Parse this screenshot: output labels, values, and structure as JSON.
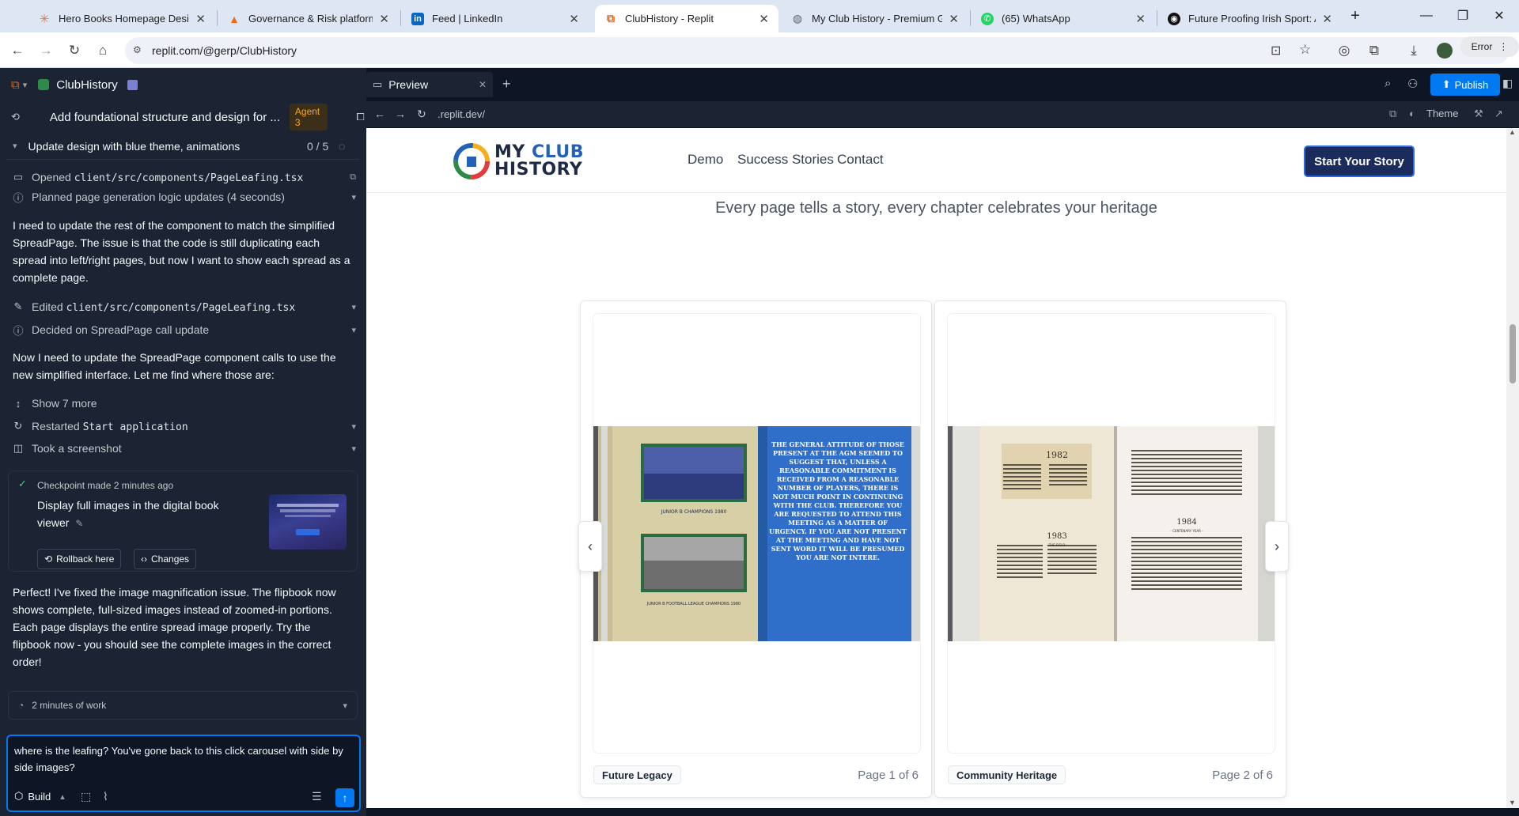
{
  "browser": {
    "tabs": [
      {
        "title": "Hero Books Homepage Design",
        "icon": "asterisk-icon",
        "color": "#d97757"
      },
      {
        "title": "Governance & Risk platform",
        "icon": "triangle-icon",
        "color": "#f26b1d"
      },
      {
        "title": "Feed | LinkedIn",
        "icon": "linkedin-icon",
        "color": "#0a66c2"
      },
      {
        "title": "ClubHistory - Replit",
        "icon": "replit-icon",
        "color": "#f26207"
      },
      {
        "title": "My Club History - Premium GAA",
        "icon": "globe-icon",
        "color": "#5f6368"
      },
      {
        "title": "(65) WhatsApp",
        "icon": "whatsapp-icon",
        "color": "#25d366"
      },
      {
        "title": "Future Proofing Irish Sport: AI a",
        "icon": "circle-logo-icon",
        "color": "#111111"
      }
    ],
    "active_tab_index": 3,
    "url": "replit.com/@gerp/ClubHistory",
    "error_label": "Error"
  },
  "replit": {
    "app_name": "ClubHistory",
    "task_title": "Add foundational structure and design for ...",
    "agent_badge": "Agent 3",
    "plan_title": "Update design with blue theme, animations",
    "plan_progress": "0 / 5",
    "activity": [
      {
        "icon": "book-icon",
        "prefix": "Opened ",
        "code": "client/src/components/PageLeafing.tsx"
      },
      {
        "icon": "info-icon",
        "text": "Planned page generation logic updates (4 seconds)"
      }
    ],
    "message1": "I need to update the rest of the component to match the simplified SpreadPage. The issue is that the code is still duplicating each spread into left/right pages, but now I want to show each spread as a complete page.",
    "activity2": [
      {
        "icon": "edit-icon",
        "prefix": "Edited ",
        "code": "client/src/components/PageLeafing.tsx"
      },
      {
        "icon": "info-icon",
        "text": "Decided on SpreadPage call update"
      }
    ],
    "message2": "Now I need to update the SpreadPage component calls to use the new simplified interface. Let me find where those are:",
    "show_more": "Show 7 more",
    "restarted_prefix": "Restarted ",
    "restarted_code": "Start application",
    "screenshot_label": "Took a screenshot",
    "checkpoint": {
      "header_prefix": "Checkpoint made",
      "header_time": "2 minutes ago",
      "title": "Display full images in the digital book viewer",
      "rollback_label": "Rollback here",
      "changes_label": "Changes"
    },
    "message3": "Perfect! I've fixed the image magnification issue. The flipbook now shows complete, full-sized images instead of zoomed-in portions. Each page displays the entire spread image properly. Try the flipbook now - you should see the complete images in the correct order!",
    "work_label": "2 minutes of work",
    "input_text": "where is the leafing? You've gone back to this click carousel with side by side images?",
    "build_label": "Build",
    "preview_tab": "Preview",
    "publish_label": "Publish",
    "preview_url": ".replit.dev/",
    "theme_label": "Theme"
  },
  "site": {
    "logo_line1_a": "MY ",
    "logo_line1_b": "CLUB",
    "logo_line2": "HISTORY",
    "nav": [
      "Demo",
      "Success Stories",
      "Contact"
    ],
    "cta": "Start Your Story",
    "tagline": "Every page tells a story, every chapter celebrates your heritage",
    "pages": [
      {
        "label": "Future Legacy",
        "page": "Page 1 of 6"
      },
      {
        "label": "Community Heritage",
        "page": "Page 2 of 6"
      }
    ],
    "spread1_caption_top": "JUNIOR B CHAMPIONS 1980",
    "spread1_caption_bottom": "JUNIOR B FOOTBALL LEAGUE CHAMPIONS 1980",
    "spread1_quote": "THE GENERAL ATTITUDE OF THOSE PRESENT AT THE AGM SEEMED TO SUGGEST THAT, UNLESS A REASONABLE COMMITMENT IS RECEIVED FROM A REASONABLE NUMBER OF PLAYERS, THERE IS NOT MUCH POINT IN CONTINUING WITH THE CLUB. THEREFORE YOU ARE REQUESTED TO ATTEND THIS MEETING AS A MATTER OF URGENCY. IF YOU ARE NOT PRESENT AT THE MEETING AND HAVE NOT SENT WORD IT WILL BE PRESUMED YOU ARE NOT INTERE.",
    "spread2_years": [
      "1982",
      "1983",
      "1984"
    ],
    "spread2_sub": [
      "- THE FIELD -",
      "- CENTENARY YEAR -"
    ]
  }
}
